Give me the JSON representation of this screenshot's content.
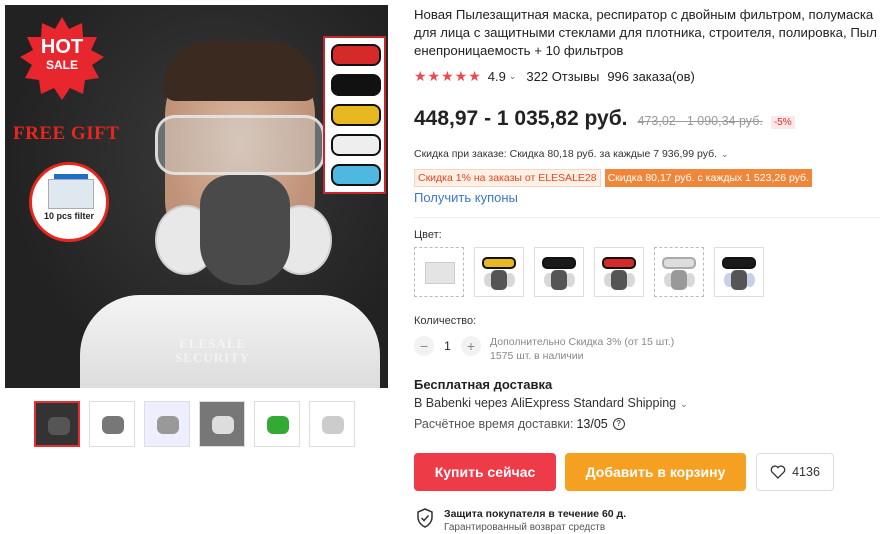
{
  "product": {
    "title": "Новая Пылезащитная маска, респиратор с двойным фильтром, полумаска для лица с защитными стеклами для плотника, строителя, полировка, Пыленепроницаемость + 10 фильтров",
    "rating": "4.9",
    "reviews": "322 Отзывы",
    "orders": "996 заказа(ов)",
    "price": "448,97 - 1 035,82 руб.",
    "old_price": "473,02 - 1 090,34 руб.",
    "discount": "-5%",
    "coupon_line": "Скидка при заказе: Скидка 80,18 руб. за каждые 7 936,99 руб.",
    "tag_store": "Скидка 1% на заказы от ELESALE28",
    "tag_coupon": "Скидка 80,17 руб. с каждых 1 523,26 руб.",
    "get_coupons": "Получить купоны",
    "color_label": "Цвет:",
    "quantity_label": "Количество:",
    "quantity": "1",
    "extra_discount": "Дополнительно Скидка 3% (от 15 шт.)",
    "stock": "1575 шт. в наличии"
  },
  "image_text": {
    "hot": "HOT",
    "sale": "SALE",
    "free_gift": "FREE GIFT",
    "filter_label": "10 pcs filter",
    "watermark_1": "ELESALE",
    "watermark_2": "SECURITY"
  },
  "shipping": {
    "title": "Бесплатная доставка",
    "line": "В Babenki через AliExpress Standard Shipping",
    "delivery_label": "Расчётное время доставки:",
    "delivery_date": "13/05"
  },
  "actions": {
    "buy_now": "Купить сейчас",
    "add_to_cart": "Добавить в корзину",
    "wishlist_count": "4136"
  },
  "protection": {
    "title": "Защита покупателя в течение 60 д.",
    "subtitle": "Гарантированный возврат средств"
  },
  "swatch_colors": [
    "none",
    "#e8b820",
    "#1a1a1a",
    "#d42a2a",
    "#dddddd",
    "#1a1a1a"
  ],
  "goggle_strip_colors": [
    "#d42a2a",
    "#111111",
    "#e8b820",
    "#eeeeee",
    "#4fb8e0"
  ],
  "colors": {
    "accent_red": "#ee3b47",
    "accent_orange": "#f5a021",
    "star": "#f0464f",
    "link": "#3a79c8"
  }
}
